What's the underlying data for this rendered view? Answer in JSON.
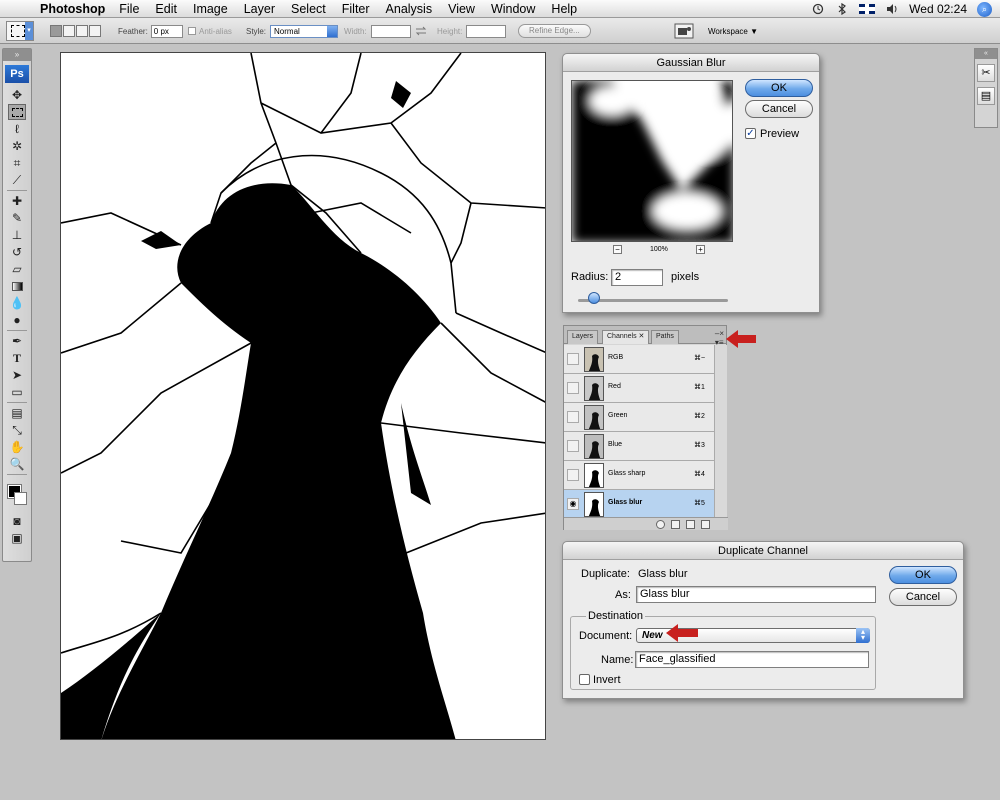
{
  "menubar": {
    "app": "Photoshop",
    "items": [
      "File",
      "Edit",
      "Image",
      "Layer",
      "Select",
      "Filter",
      "Analysis",
      "View",
      "Window",
      "Help"
    ],
    "clock": "Wed 02:24"
  },
  "options": {
    "feather_label": "Feather:",
    "feather_value": "0 px",
    "antialias_label": "Anti-alias",
    "style_label": "Style:",
    "style_value": "Normal",
    "width_label": "Width:",
    "height_label": "Height:",
    "refine_edge": "Refine Edge...",
    "workspace": "Workspace ▼"
  },
  "toolbox": {
    "logo": "Ps"
  },
  "gaussian": {
    "title": "Gaussian Blur",
    "ok": "OK",
    "cancel": "Cancel",
    "preview_label": "Preview",
    "zoom": "100%",
    "zoom_minus": "−",
    "zoom_plus": "+",
    "radius_label": "Radius:",
    "radius_value": "2",
    "radius_unit": "pixels"
  },
  "channels": {
    "tabs": [
      "Layers",
      "Channels ✕",
      "Paths"
    ],
    "rows": [
      {
        "name": "RGB",
        "key": "⌘~"
      },
      {
        "name": "Red",
        "key": "⌘1"
      },
      {
        "name": "Green",
        "key": "⌘2"
      },
      {
        "name": "Blue",
        "key": "⌘3"
      },
      {
        "name": "Glass sharp",
        "key": "⌘4"
      },
      {
        "name": "Glass blur",
        "key": "⌘5"
      }
    ]
  },
  "duplicate": {
    "title": "Duplicate Channel",
    "duplicate_label": "Duplicate:",
    "duplicate_value": "Glass blur",
    "as_label": "As:",
    "as_value": "Glass blur",
    "destination_label": "Destination",
    "document_label": "Document:",
    "document_value": "New",
    "name_label": "Name:",
    "name_value": "Face_glassified",
    "invert_label": "Invert",
    "ok": "OK",
    "cancel": "Cancel"
  },
  "colors": {
    "accent": "#4d8fe0",
    "arrow": "#c8201e",
    "selected_row": "#b7d3f0"
  }
}
